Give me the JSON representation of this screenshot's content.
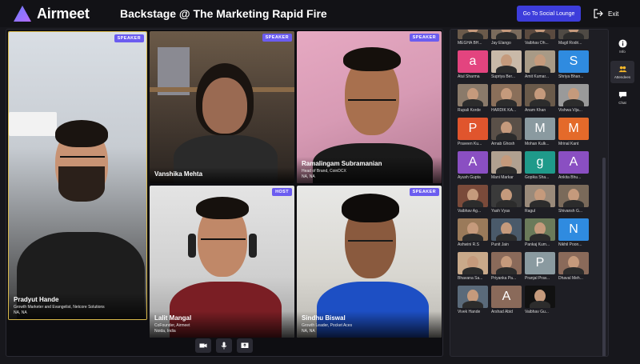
{
  "header": {
    "brand": "Airmeet",
    "event_title": "Backstage @ The Marketing Rapid Fire",
    "social_button": "Go To Social Lounge",
    "exit_label": "Exit"
  },
  "stage": {
    "tiles": [
      {
        "badge": "SPEAKER",
        "name": "Pradyut Hande",
        "role": "Growth Marketer and Evangelist, Netcore Solutions",
        "location": "NA, NA"
      },
      {
        "badge": "SPEAKER",
        "name": "Vanshika Mehta",
        "role": "",
        "location": ""
      },
      {
        "badge": "SPEAKER",
        "name": "Ramalingam Subramanian",
        "role": "Head of Brand, CoinDCX",
        "location": "NA, NA"
      },
      {
        "badge": "HOST",
        "name": "Lalit Mangal",
        "role": "CoFounder, Airmeet",
        "location": "Noida, India"
      },
      {
        "badge": "SPEAKER",
        "name": "Sindhu Biswal",
        "role": "Growth Leader, Pocket Aces",
        "location": "NA, NA"
      }
    ],
    "controls": [
      "camera-icon",
      "mic-icon",
      "screen-share-icon"
    ]
  },
  "attendees": [
    {
      "name": "MEGHA BH...",
      "initial": "",
      "color": "#6b5a4a"
    },
    {
      "name": "Jay Elango",
      "initial": "",
      "color": "#7a6b5c"
    },
    {
      "name": "Vaibhav Dh...",
      "initial": "",
      "color": "#5b4a3f"
    },
    {
      "name": "Magil Rodri...",
      "initial": "",
      "color": "#4f4a44"
    },
    {
      "name": "Atul Sharma",
      "initial": "a",
      "color": "#e3447f"
    },
    {
      "name": "Supriya Ber...",
      "initial": "",
      "color": "#c9b9a8"
    },
    {
      "name": "Amit Kumar...",
      "initial": "",
      "color": "#a89a86"
    },
    {
      "name": "Shriya Bhan...",
      "initial": "S",
      "color": "#2f8be0"
    },
    {
      "name": "Rupali Korde",
      "initial": "",
      "color": "#8a7a6a"
    },
    {
      "name": "HARDIK KA...",
      "initial": "",
      "color": "#8a6f5a"
    },
    {
      "name": "Anam Khan",
      "initial": "",
      "color": "#6a5a4a"
    },
    {
      "name": "Vishwa Vija...",
      "initial": "",
      "color": "#9a9a9a"
    },
    {
      "name": "Praveen Ku...",
      "initial": "P",
      "color": "#e0552d"
    },
    {
      "name": "Arnab Ghosh",
      "initial": "",
      "color": "#5a5048"
    },
    {
      "name": "Mohan Kulk...",
      "initial": "M",
      "color": "#8a9aa0"
    },
    {
      "name": "Mrinal Kant",
      "initial": "M",
      "color": "#e46a2a"
    },
    {
      "name": "Ayush Gupta",
      "initial": "A",
      "color": "#8a4fc2"
    },
    {
      "name": "Mani Markar",
      "initial": "",
      "color": "#b0a090"
    },
    {
      "name": "Gopika Sha...",
      "initial": "g",
      "color": "#1f9a8a"
    },
    {
      "name": "Ankita Bhu...",
      "initial": "A",
      "color": "#8a4fc2"
    },
    {
      "name": "Vaibhav Ag...",
      "initial": "",
      "color": "#7a4a3a"
    },
    {
      "name": "Yash Vyas",
      "initial": "",
      "color": "#3a3a3a"
    },
    {
      "name": "Ragul",
      "initial": "",
      "color": "#9a8a7a"
    },
    {
      "name": "Shivansh G...",
      "initial": "",
      "color": "#7a6a5a"
    },
    {
      "name": "Ashwini R.S",
      "initial": "",
      "color": "#9a7a5a"
    },
    {
      "name": "Punit Jain",
      "initial": "",
      "color": "#4a5a6a"
    },
    {
      "name": "Pankaj Kum...",
      "initial": "",
      "color": "#6a7a5a"
    },
    {
      "name": "Nikhil Poon...",
      "initial": "N",
      "color": "#2f8be0"
    },
    {
      "name": "Bhavana Sa...",
      "initial": "",
      "color": "#c9a98a"
    },
    {
      "name": "Priyanka Pa...",
      "initial": "",
      "color": "#8a6a5a"
    },
    {
      "name": "Pranjal Prav...",
      "initial": "P",
      "color": "#8a9aa0"
    },
    {
      "name": "Dhaval Meh...",
      "initial": "",
      "color": "#8a6a5a"
    },
    {
      "name": "Vivek Hande",
      "initial": "",
      "color": "#5a6a7a"
    },
    {
      "name": "Arshad Abid",
      "initial": "A",
      "color": "#8a6a5a"
    },
    {
      "name": "Vaibhav Gu...",
      "initial": "",
      "color": "#111111"
    }
  ],
  "rail": [
    {
      "icon": "info-icon",
      "label": "Info"
    },
    {
      "icon": "attendees-icon",
      "label": "Attendees"
    },
    {
      "icon": "chat-icon",
      "label": "Chat"
    }
  ]
}
